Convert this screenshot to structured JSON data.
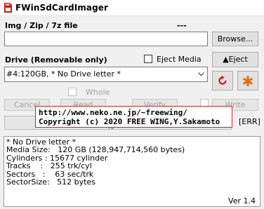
{
  "window": {
    "title": "FWinSdCardImager"
  },
  "image_section": {
    "label": "Img / Zip / 7z file",
    "status": "---",
    "path_value": "",
    "browse_label": "Browse..."
  },
  "drive_section": {
    "label": "Drive (Removable only)",
    "eject_media_label": "Eject Media",
    "eject_media_checked": false,
    "eject_button_label": "▲Eject",
    "selected_drive": "#4:120GB, * No Drive letter *",
    "refresh_icon": "refresh-icon",
    "settings_icon": "asterisk-icon"
  },
  "whole_label": "Whole",
  "buttons": {
    "cancel": "Cancel",
    "read": "Read",
    "verify": "Verify",
    "write": "Write"
  },
  "progress": {
    "value_text": "%",
    "status": "[ERR]"
  },
  "tooltip": {
    "line1": "http://www.neko.ne.jp/~freewing/",
    "line2": "Copyright (c) 2020 FREE WING,Y.Sakamoto"
  },
  "info": {
    "lines": [
      "* No Drive letter *",
      "Media Size:   120 GB (128,947,714,560 bytes)",
      "Cylinders : 15677 cylinder",
      "Tracks    :   255 trk/cyl",
      "Sectors   :    63 sec/trk",
      "SectorSize:   512 bytes"
    ],
    "version": "Ver 1.4"
  },
  "colors": {
    "accent_red": "#c82828",
    "refresh_red": "#d01818",
    "asterisk_orange": "#e07010"
  }
}
